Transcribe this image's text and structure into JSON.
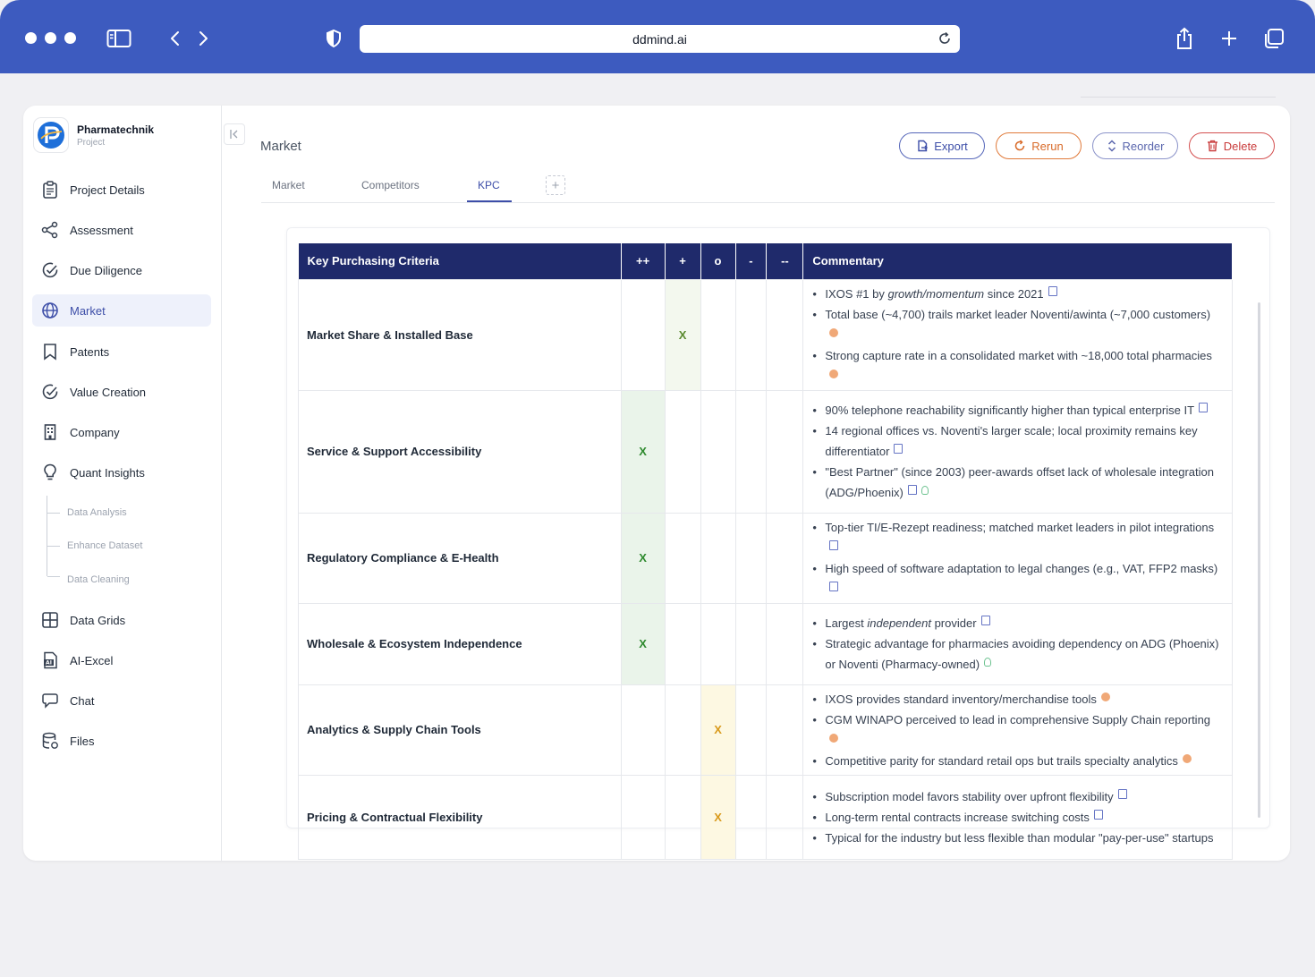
{
  "browser": {
    "url": "ddmind.ai"
  },
  "brand": {
    "name": "Pharmatechnik",
    "sub": "Project"
  },
  "sidebar": {
    "items": [
      {
        "label": "Project Details",
        "icon": "clipboard-icon"
      },
      {
        "label": "Assessment",
        "icon": "share-icon"
      },
      {
        "label": "Due Diligence",
        "icon": "check-circle-icon"
      },
      {
        "label": "Market",
        "icon": "globe-icon",
        "active": true
      },
      {
        "label": "Patents",
        "icon": "bookmark-icon"
      },
      {
        "label": "Value Creation",
        "icon": "check-circle-icon"
      },
      {
        "label": "Company",
        "icon": "building-icon"
      },
      {
        "label": "Quant Insights",
        "icon": "lightbulb-icon"
      },
      {
        "label": "Data Grids",
        "icon": "grid-icon"
      },
      {
        "label": "AI-Excel",
        "icon": "ai-file-icon"
      },
      {
        "label": "Chat",
        "icon": "chat-icon"
      },
      {
        "label": "Files",
        "icon": "database-icon"
      }
    ],
    "sub_items": [
      "Data Analysis",
      "Enhance Dataset",
      "Data Cleaning"
    ]
  },
  "header": {
    "title": "Market"
  },
  "actions": {
    "export": "Export",
    "rerun": "Rerun",
    "reorder": "Reorder",
    "delete": "Delete"
  },
  "tabs": [
    "Market",
    "Competitors",
    "KPC"
  ],
  "table": {
    "headers": [
      "Key Purchasing Criteria",
      "++",
      "+",
      "o",
      "-",
      "--",
      "Commentary"
    ],
    "mark": "X",
    "rows": [
      {
        "criterion": "Market Share & Installed Base",
        "score": "+",
        "comments": [
          {
            "pre": "IXOS #1 by ",
            "em": "growth/momentum",
            "post": " since 2021",
            "src": [
              "doc"
            ]
          },
          {
            "pre": "Total base (~4,700) trails market leader Noventi/awinta (~7,000 customers)",
            "src": [
              "web"
            ]
          },
          {
            "pre": "Strong capture rate in a consolidated market with ~18,000 total pharmacies",
            "src": [
              "web"
            ]
          }
        ]
      },
      {
        "criterion": "Service & Support Accessibility",
        "score": "++",
        "comments": [
          {
            "pre": "90% telephone reachability significantly higher than typical enterprise IT",
            "src": [
              "doc"
            ]
          },
          {
            "pre": "14 regional offices vs. Noventi's larger scale; local proximity remains key differentiator",
            "src": [
              "doc"
            ]
          },
          {
            "pre": "\"Best Partner\" (since 2003) peer-awards offset lack of wholesale integration (ADG/Phoenix)",
            "src": [
              "doc",
              "bulb"
            ]
          }
        ]
      },
      {
        "criterion": "Regulatory Compliance & E-Health",
        "score": "++",
        "comments": [
          {
            "pre": "Top-tier TI/E-Rezept readiness; matched market leaders in pilot integrations",
            "src": [
              "doc"
            ]
          },
          {
            "pre": "High speed of software adaptation to legal changes (e.g., VAT, FFP2 masks)",
            "src": [
              "doc"
            ]
          }
        ]
      },
      {
        "criterion": "Wholesale & Ecosystem Independence",
        "score": "++",
        "comments": [
          {
            "pre": "Largest ",
            "em": "independent",
            "post": " provider",
            "src": [
              "doc"
            ]
          },
          {
            "pre": "Strategic advantage for pharmacies avoiding dependency on ADG (Phoenix) or Noventi (Pharmacy-owned)",
            "src": [
              "bulb"
            ]
          }
        ]
      },
      {
        "criterion": "Analytics & Supply Chain Tools",
        "score": "o",
        "comments": [
          {
            "pre": "IXOS provides standard inventory/merchandise tools",
            "src": [
              "web"
            ]
          },
          {
            "pre": "CGM WINAPO perceived to lead in comprehensive Supply Chain reporting",
            "src": [
              "web"
            ]
          },
          {
            "pre": "Competitive parity for standard retail ops but trails specialty analytics",
            "src": [
              "web"
            ]
          }
        ]
      },
      {
        "criterion": "Pricing & Contractual Flexibility",
        "score": "o",
        "comments": [
          {
            "pre": "Subscription model favors stability over upfront flexibility",
            "src": [
              "doc"
            ]
          },
          {
            "pre": "Long-term rental contracts increase switching costs",
            "src": [
              "doc"
            ]
          },
          {
            "pre": "Typical for the industry but less flexible than modular \"pay-per-use\" startups",
            "src": []
          }
        ]
      }
    ]
  },
  "colors": {
    "chrome": "#3d5bbf",
    "header_bg": "#1f2a6b",
    "accent": "#3d4ea8"
  }
}
